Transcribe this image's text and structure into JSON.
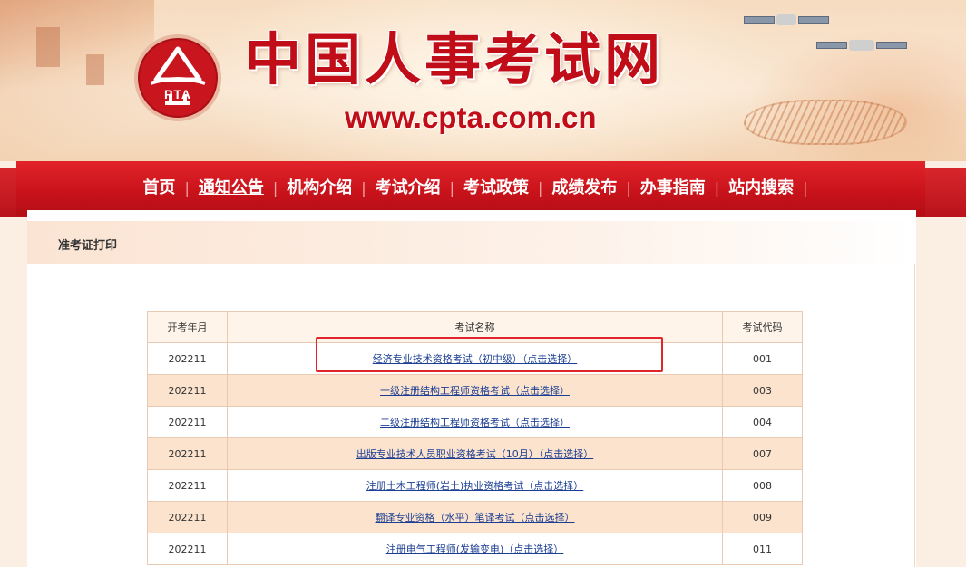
{
  "header": {
    "logo_text": "PTA",
    "title": "中国人事考试网",
    "url": "www.cpta.com.cn"
  },
  "nav": {
    "items": [
      {
        "label": "首页"
      },
      {
        "label": "通知公告"
      },
      {
        "label": "机构介绍"
      },
      {
        "label": "考试介绍"
      },
      {
        "label": "考试政策"
      },
      {
        "label": "成绩发布"
      },
      {
        "label": "办事指南"
      },
      {
        "label": "站内搜索"
      }
    ],
    "current_index": 1
  },
  "breadcrumb": {
    "title": "准考证打印"
  },
  "table": {
    "headers": [
      "开考年月",
      "考试名称",
      "考试代码"
    ],
    "rows": [
      {
        "date": "202211",
        "name": "经济专业技术资格考试（初中级）（点击选择）",
        "code": "001"
      },
      {
        "date": "202211",
        "name": "一级注册结构工程师资格考试（点击选择）",
        "code": "003"
      },
      {
        "date": "202211",
        "name": "二级注册结构工程师资格考试（点击选择）",
        "code": "004"
      },
      {
        "date": "202211",
        "name": "出版专业技术人员职业资格考试（10月）（点击选择）",
        "code": "007"
      },
      {
        "date": "202211",
        "name": "注册土木工程师(岩土)执业资格考试（点击选择）",
        "code": "008"
      },
      {
        "date": "202211",
        "name": "翻译专业资格（水平）笔译考试（点击选择）",
        "code": "009"
      },
      {
        "date": "202211",
        "name": "注册电气工程师(发输变电)（点击选择）",
        "code": "011"
      }
    ]
  },
  "colors": {
    "brand_red": "#c9151e",
    "link_blue": "#1c3f94",
    "highlight_red": "#e0262c"
  }
}
